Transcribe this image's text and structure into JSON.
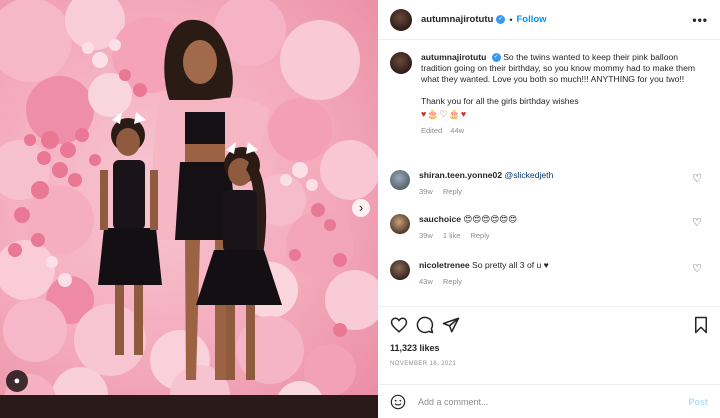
{
  "header": {
    "username": "autumnajirotutu",
    "separator": "•",
    "follow_label": "Follow",
    "more_label": "•••"
  },
  "caption": {
    "username": "autumnajirotutu",
    "text": "So the twins wanted to keep their pink balloon tradition going on their birthday, so you know mommy had to make them what they wanted. Love you both so much!!! ANYTHING for you two!!",
    "thanks": "Thank you for all the girls birthday wishes",
    "emojis": "♥🎂♡🎂♥",
    "edited": "Edited",
    "age": "44w"
  },
  "comments": [
    {
      "username": "shiran.teen.yonne02",
      "mention": "@slickedjeth",
      "text": "",
      "age": "39w",
      "likes": "",
      "reply": "Reply"
    },
    {
      "username": "sauchoice",
      "mention": "",
      "text": "😍😍😍😍😍😍",
      "age": "39w",
      "likes": "1 like",
      "reply": "Reply"
    },
    {
      "username": "nicoletrenee",
      "mention": "",
      "text": "So pretty all 3 of u ♥",
      "age": "43w",
      "likes": "",
      "reply": "Reply"
    }
  ],
  "likes": "11,323 likes",
  "date": "NOVEMBER 16, 2021",
  "add_comment": {
    "placeholder": "Add a comment...",
    "post_label": "Post"
  },
  "colors": {
    "accent": "#0095f6",
    "balloon_light": "#f7c4d1",
    "balloon_mid": "#f29bb2",
    "balloon_dark": "#e86e8f"
  }
}
